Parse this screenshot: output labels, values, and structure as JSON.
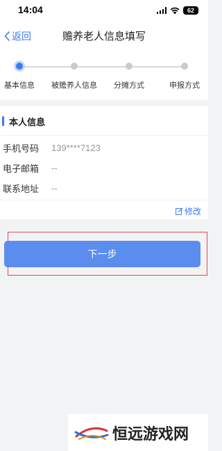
{
  "status_bar": {
    "time": "14:04",
    "battery": "62",
    "icons": [
      "signal-icon",
      "wifi-icon",
      "battery-icon"
    ]
  },
  "nav": {
    "back_label": "返回",
    "title": "赡养老人信息填写",
    "back_icon": "chevron-left-icon"
  },
  "steps": {
    "items": [
      {
        "label": "基本信息",
        "active": true
      },
      {
        "label": "被赡养人信息",
        "active": false
      },
      {
        "label": "分摊方式",
        "active": false
      },
      {
        "label": "申报方式",
        "active": false
      }
    ]
  },
  "personal_info": {
    "section_title": "本人信息",
    "fields": [
      {
        "label": "手机号码",
        "value": "139****7123"
      },
      {
        "label": "电子邮箱",
        "value": "--"
      },
      {
        "label": "联系地址",
        "value": "--"
      }
    ],
    "edit_label": "修改",
    "edit_icon": "edit-icon"
  },
  "actions": {
    "next_label": "下一步"
  },
  "watermark": {
    "text": "恒远游戏网"
  },
  "colors": {
    "accent": "#3a7bf0",
    "button": "#5b8def",
    "highlight": "#e24a4a",
    "background": "#f2f3f5"
  }
}
